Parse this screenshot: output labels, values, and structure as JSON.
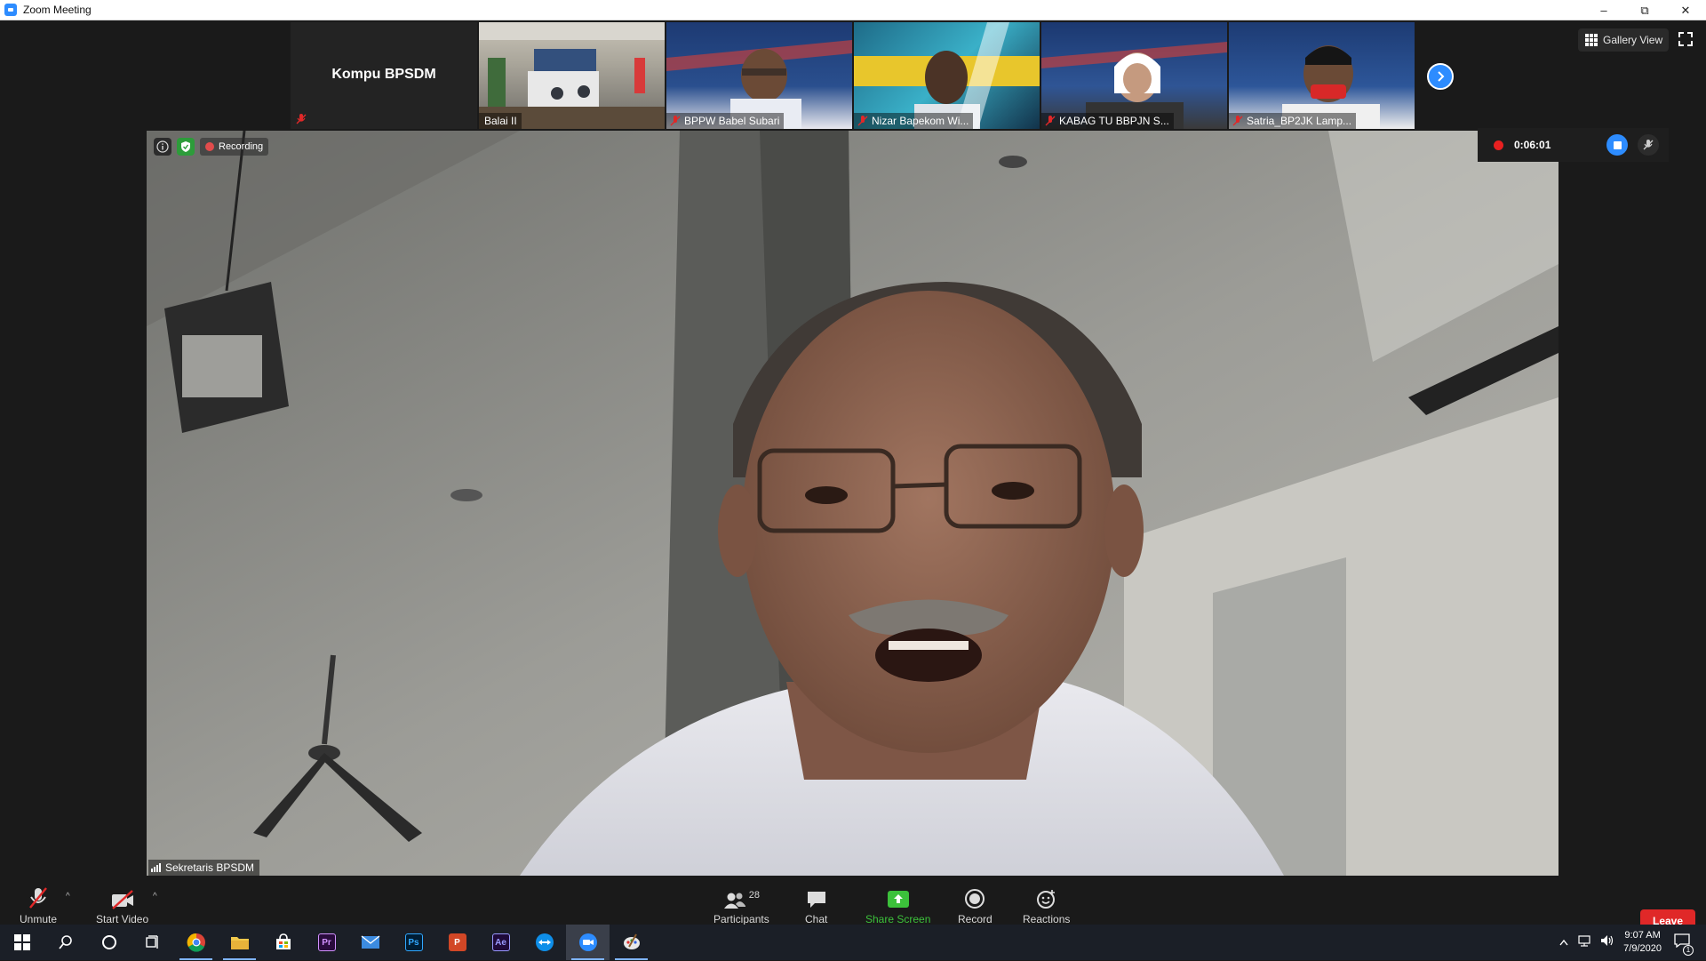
{
  "window": {
    "title": "Zoom Meeting",
    "controls": [
      "minimize",
      "restore",
      "close"
    ]
  },
  "top_strip": {
    "name_tile": "Kompu BPSDM",
    "thumbnails": [
      {
        "label": "Balai II",
        "muted": false,
        "bg": "#8b8f86"
      },
      {
        "label": "BPPW Babel Subari",
        "muted": true,
        "bg": "#27406e"
      },
      {
        "label": "Nizar Bapekom Wi...",
        "muted": true,
        "bg": "#2f8fa8"
      },
      {
        "label": "KABAG TU BBPJN S...",
        "muted": true,
        "bg": "#2a4475"
      },
      {
        "label": "Satria_BP2JK Lamp...",
        "muted": true,
        "bg": "#2b487c"
      }
    ],
    "gallery_view_label": "Gallery View"
  },
  "main_video": {
    "recording_label": "Recording",
    "speaker_name": "Sekretaris BPSDM"
  },
  "recording_panel": {
    "elapsed": "0:06:01"
  },
  "toolbar": {
    "unmute": "Unmute",
    "start_video": "Start Video",
    "participants": "Participants",
    "participants_count": "28",
    "chat": "Chat",
    "share_screen": "Share Screen",
    "record": "Record",
    "reactions": "Reactions",
    "leave": "Leave"
  },
  "taskbar": {
    "time": "9:07 AM",
    "date": "7/9/2020",
    "notification_count": "1",
    "apps": [
      "windows-start",
      "search",
      "cortana",
      "task-view",
      "chrome",
      "file-explorer",
      "store",
      "premiere",
      "mail",
      "photoshop",
      "powerpoint",
      "after-effects",
      "teamviewer",
      "zoom",
      "paint"
    ]
  },
  "colors": {
    "accent": "#2d8cff",
    "leave": "#e02828",
    "share": "#3cc13b",
    "muted_icon": "#e02828"
  }
}
